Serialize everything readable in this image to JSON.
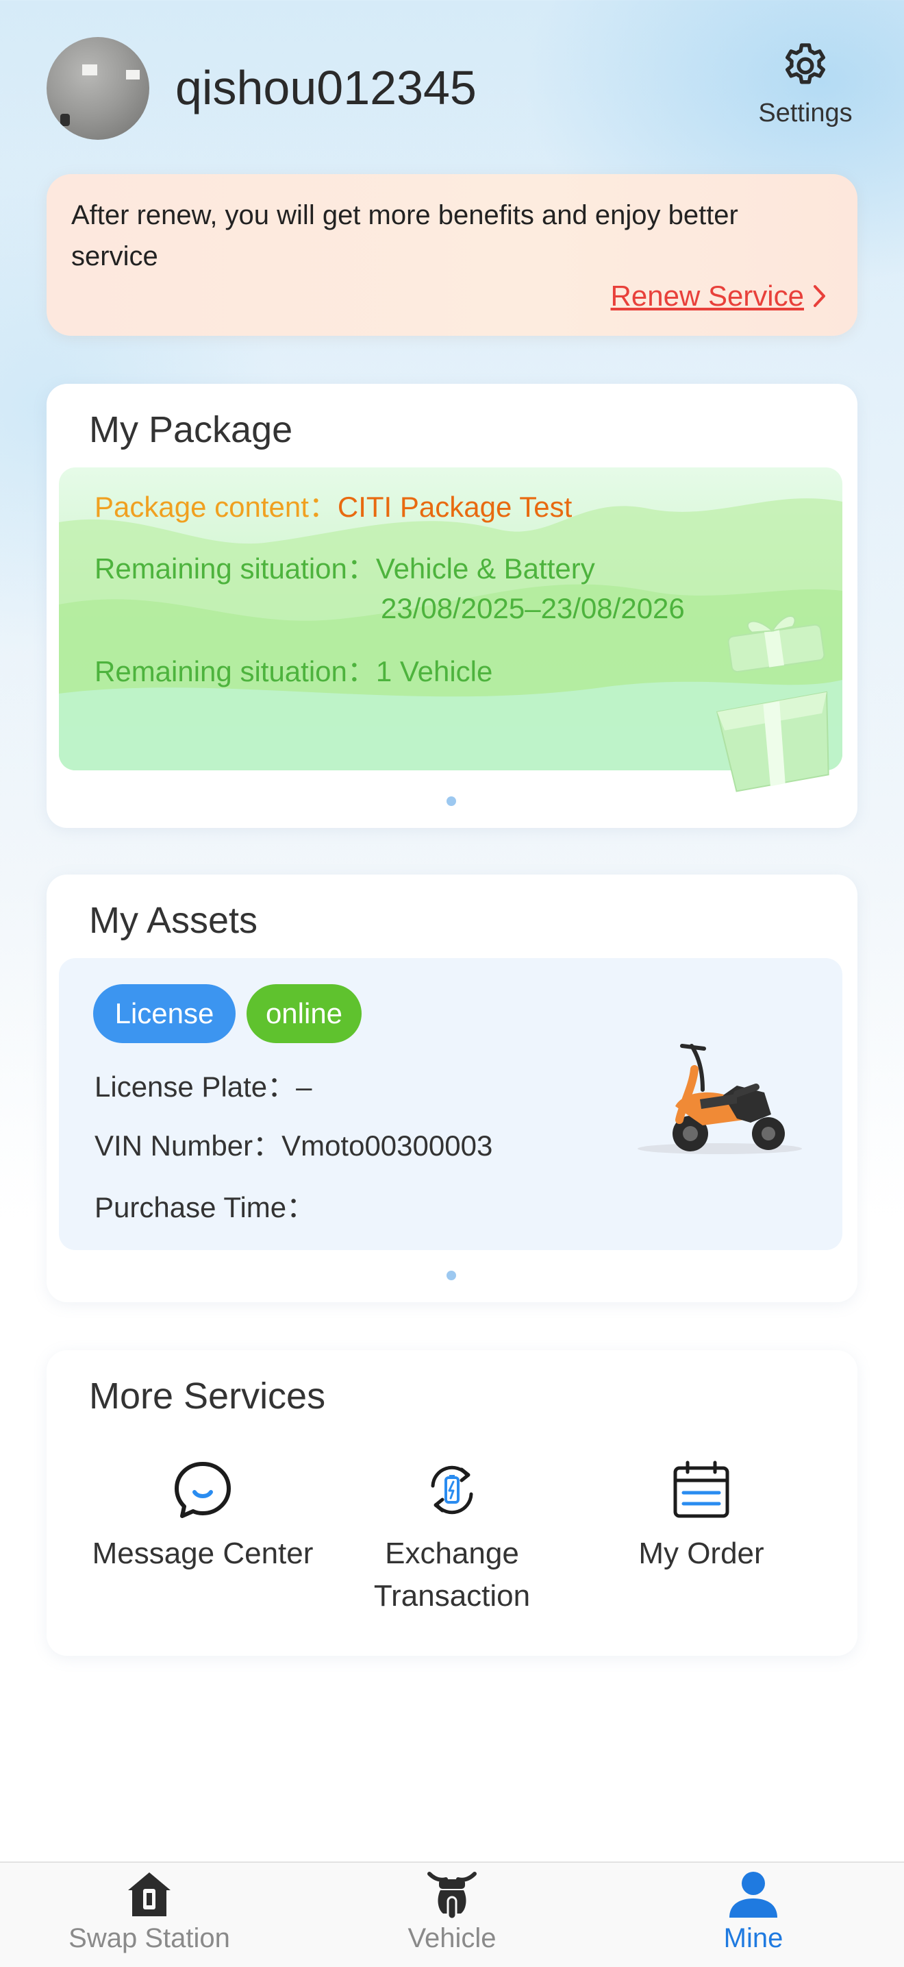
{
  "header": {
    "username": "qishou012345",
    "settings_label": "Settings"
  },
  "renew_banner": {
    "message": "After renew, you will get more benefits and enjoy better service",
    "link_label": "Renew Service"
  },
  "package": {
    "title": "My Package",
    "content_label": "Package content：",
    "content_value": "CITI Package Test",
    "remaining_label_1": "Remaining situation：",
    "remaining_value_1a": "Vehicle & Battery",
    "remaining_value_1b": "23/08/2025–23/08/2026",
    "remaining_label_2": "Remaining situation：",
    "remaining_value_2": "1 Vehicle",
    "label_color": "#4db33d",
    "accent_color": "#f0a020"
  },
  "assets": {
    "title": "My Assets",
    "tag_license": "License",
    "tag_online": "online",
    "plate_label": "License Plate：",
    "plate_value": "–",
    "vin_label": "VIN Number：",
    "vin_value": "Vmoto00300003",
    "purchase_label": "Purchase Time："
  },
  "services": {
    "title": "More Services",
    "items": [
      {
        "label": "Message Center",
        "icon": "chat-bubble-icon"
      },
      {
        "label": "Exchange Transaction",
        "icon": "battery-exchange-icon"
      },
      {
        "label": "My Order",
        "icon": "calendar-list-icon"
      }
    ]
  },
  "nav": {
    "items": [
      {
        "label": "Swap Station",
        "icon": "swap-station-icon",
        "active": false
      },
      {
        "label": "Vehicle",
        "icon": "scooter-icon",
        "active": false
      },
      {
        "label": "Mine",
        "icon": "user-icon",
        "active": true
      }
    ],
    "active_color": "#1f7ae0",
    "inactive_color": "#8a8a8a"
  }
}
